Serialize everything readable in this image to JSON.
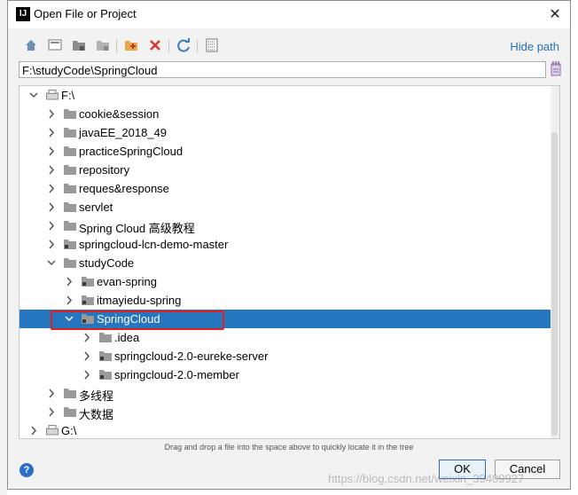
{
  "dialog": {
    "title": "Open File or Project",
    "app_icon_text": "IJ",
    "close_glyph": "✕",
    "toolbar": {
      "icons": [
        "home-icon",
        "desktop-icon",
        "project-icon",
        "module-icon",
        "new-folder-icon",
        "delete-icon",
        "refresh-icon",
        "toggle-hidden-icon"
      ],
      "hide_path_label": "Hide path"
    },
    "path_value": "F:\\studyCode\\SpringCloud",
    "tree": [
      {
        "label": "F:\\",
        "depth": 0,
        "expanded": true,
        "icon": "drive"
      },
      {
        "label": "cookie&session",
        "depth": 1,
        "expanded": false,
        "icon": "folder"
      },
      {
        "label": "javaEE_2018_49",
        "depth": 1,
        "expanded": false,
        "icon": "folder"
      },
      {
        "label": "practiceSpringCloud",
        "depth": 1,
        "expanded": false,
        "icon": "folder"
      },
      {
        "label": "repository",
        "depth": 1,
        "expanded": false,
        "icon": "folder"
      },
      {
        "label": "reques&response",
        "depth": 1,
        "expanded": false,
        "icon": "folder"
      },
      {
        "label": "servlet",
        "depth": 1,
        "expanded": false,
        "icon": "folder"
      },
      {
        "label": "Spring Cloud 高级教程",
        "depth": 1,
        "expanded": false,
        "icon": "folder"
      },
      {
        "label": "springcloud-lcn-demo-master",
        "depth": 1,
        "expanded": false,
        "icon": "project-folder"
      },
      {
        "label": "studyCode",
        "depth": 1,
        "expanded": true,
        "icon": "folder"
      },
      {
        "label": "evan-spring",
        "depth": 2,
        "expanded": false,
        "icon": "project-folder"
      },
      {
        "label": "itmayiedu-spring",
        "depth": 2,
        "expanded": false,
        "icon": "project-folder"
      },
      {
        "label": "SpringCloud",
        "depth": 2,
        "expanded": true,
        "icon": "project-folder",
        "selected": true
      },
      {
        "label": ".idea",
        "depth": 3,
        "expanded": false,
        "icon": "folder"
      },
      {
        "label": "springcloud-2.0-eureke-server",
        "depth": 3,
        "expanded": false,
        "icon": "project-folder"
      },
      {
        "label": "springcloud-2.0-member",
        "depth": 3,
        "expanded": false,
        "icon": "project-folder"
      },
      {
        "label": "多线程",
        "depth": 1,
        "expanded": false,
        "icon": "folder"
      },
      {
        "label": "大数据",
        "depth": 1,
        "expanded": false,
        "icon": "folder"
      },
      {
        "label": "G:\\",
        "depth": 0,
        "expanded": false,
        "icon": "drive"
      }
    ],
    "hint_text": "Drag and drop a file into the space above to quickly locate it in the tree",
    "help_label": "?",
    "ok_label": "OK",
    "cancel_label": "Cancel"
  },
  "watermark": "https://blog.csdn.net/weixin_39409927",
  "colors": {
    "selection": "#2675bf",
    "link": "#2470b3",
    "highlight_box": "#e02020"
  }
}
